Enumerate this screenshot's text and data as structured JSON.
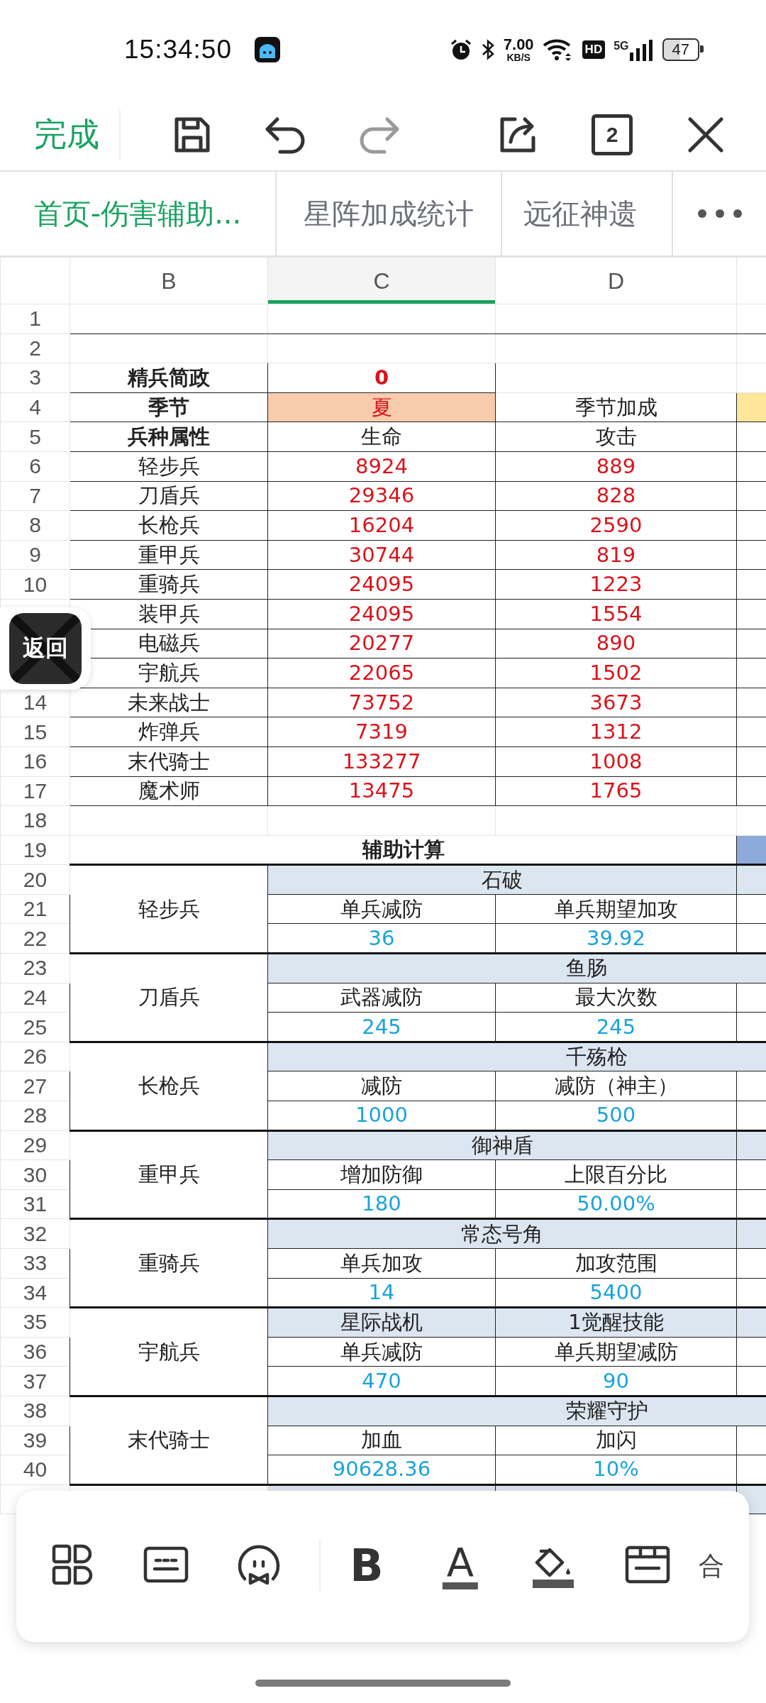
{
  "status_bar": {
    "time": "15:34:50",
    "speed_value": "7.00",
    "speed_unit": "KB/S",
    "hd": "HD",
    "network": "5G",
    "battery": "47"
  },
  "toolbar": {
    "done": "完成",
    "buttons": [
      {
        "kind": "save",
        "disabled": false
      },
      {
        "kind": "undo",
        "disabled": false
      },
      {
        "kind": "redo",
        "disabled": true
      },
      {
        "kind": "share",
        "disabled": false
      },
      {
        "kind": "windows",
        "label": "2",
        "disabled": false
      },
      {
        "kind": "close",
        "disabled": false
      }
    ]
  },
  "sheet_tabs": [
    {
      "label": "首页-伤害辅助...",
      "selected": true
    },
    {
      "label": "星阵加成统计",
      "selected": false
    },
    {
      "label": "远征神遗",
      "selected": false
    }
  ],
  "columns": [
    {
      "label": "B",
      "selected": false
    },
    {
      "label": "C",
      "selected": true
    },
    {
      "label": "D",
      "selected": false
    }
  ],
  "rows": [
    {
      "number": "1",
      "kind": "blank"
    },
    {
      "number": "2",
      "kind": "blank"
    },
    {
      "number": "3",
      "kind": "setting",
      "label": "精兵简政",
      "value": "0"
    },
    {
      "number": "4",
      "kind": "season",
      "label": "季节",
      "value": "夏",
      "note": "季节加成"
    },
    {
      "number": "5",
      "kind": "header",
      "label": "兵种属性",
      "c": "生命",
      "d": "攻击"
    },
    {
      "number": "6",
      "kind": "unit",
      "name": "轻步兵",
      "hp": "8924",
      "atk": "889"
    },
    {
      "number": "7",
      "kind": "unit",
      "name": "刀盾兵",
      "hp": "29346",
      "atk": "828"
    },
    {
      "number": "8",
      "kind": "unit",
      "name": "长枪兵",
      "hp": "16204",
      "atk": "2590"
    },
    {
      "number": "9",
      "kind": "unit",
      "name": "重甲兵",
      "hp": "30744",
      "atk": "819"
    },
    {
      "number": "10",
      "kind": "unit",
      "name": "重骑兵",
      "hp": "24095",
      "atk": "1223"
    },
    {
      "kind": "unit",
      "name": "装甲兵",
      "hp": "24095",
      "atk": "1554"
    },
    {
      "kind": "unit",
      "name": "电磁兵",
      "hp": "20277",
      "atk": "890"
    },
    {
      "kind": "unit",
      "name": "宇航兵",
      "hp": "22065",
      "atk": "1502"
    },
    {
      "number": "14",
      "kind": "unit",
      "name": "未来战士",
      "hp": "73752",
      "atk": "3673"
    },
    {
      "number": "15",
      "kind": "unit",
      "name": "炸弹兵",
      "hp": "7319",
      "atk": "1312"
    },
    {
      "number": "16",
      "kind": "unit",
      "name": "末代骑士",
      "hp": "133277",
      "atk": "1008"
    },
    {
      "number": "17",
      "kind": "unit",
      "name": "魔术师",
      "hp": "13475",
      "atk": "1765"
    },
    {
      "number": "18",
      "kind": "blank"
    },
    {
      "number": "19",
      "kind": "title",
      "text": "辅助计算"
    }
  ],
  "support_groups": [
    {
      "unit": "轻步兵",
      "numbers": [
        "20",
        "21",
        "22"
      ],
      "header": {
        "kind": "merged",
        "text": "石破"
      },
      "labels": [
        "单兵减防",
        "单兵期望加攻"
      ],
      "values": [
        "36",
        "39.92"
      ]
    },
    {
      "unit": "刀盾兵",
      "numbers": [
        "23",
        "24",
        "25"
      ],
      "header": {
        "kind": "wide",
        "text": "鱼肠"
      },
      "labels": [
        "武器减防",
        "最大次数"
      ],
      "values": [
        "245",
        "245"
      ]
    },
    {
      "unit": "长枪兵",
      "numbers": [
        "26",
        "27",
        "28"
      ],
      "header": {
        "kind": "wide",
        "text": "千殇枪"
      },
      "labels": [
        "减防",
        "减防（神主）"
      ],
      "values": [
        "1000",
        "500"
      ]
    },
    {
      "unit": "重甲兵",
      "numbers": [
        "29",
        "30",
        "31"
      ],
      "header": {
        "kind": "merged",
        "text": "御神盾"
      },
      "labels": [
        "增加防御",
        "上限百分比"
      ],
      "values": [
        "180",
        "50.00%"
      ]
    },
    {
      "unit": "重骑兵",
      "numbers": [
        "32",
        "33",
        "34"
      ],
      "header": {
        "kind": "merged",
        "text": "常态号角"
      },
      "labels": [
        "单兵加攻",
        "加攻范围"
      ],
      "values": [
        "14",
        "5400"
      ]
    },
    {
      "unit": "宇航兵",
      "numbers": [
        "35",
        "36",
        "37"
      ],
      "header": {
        "kind": "split",
        "texts": [
          "星际战机",
          "1觉醒技能"
        ]
      },
      "labels": [
        "单兵减防",
        "单兵期望减防"
      ],
      "values": [
        "470",
        "90"
      ]
    },
    {
      "unit": "末代骑士",
      "numbers": [
        "38",
        "39",
        "40"
      ],
      "header": {
        "kind": "wide",
        "text": "荣耀守护"
      },
      "labels": [
        "加血",
        "加闪"
      ],
      "values": [
        "90628.36",
        "10%"
      ]
    }
  ],
  "back_button": {
    "label": "返回"
  },
  "format_bar": {
    "items": [
      {
        "kind": "layout"
      },
      {
        "kind": "keyboard"
      },
      {
        "kind": "emoji"
      },
      {
        "kind": "bold",
        "label": "B"
      },
      {
        "kind": "font_color",
        "label": "A"
      },
      {
        "kind": "fill"
      },
      {
        "kind": "border"
      },
      {
        "kind": "text",
        "label": "合"
      }
    ]
  }
}
